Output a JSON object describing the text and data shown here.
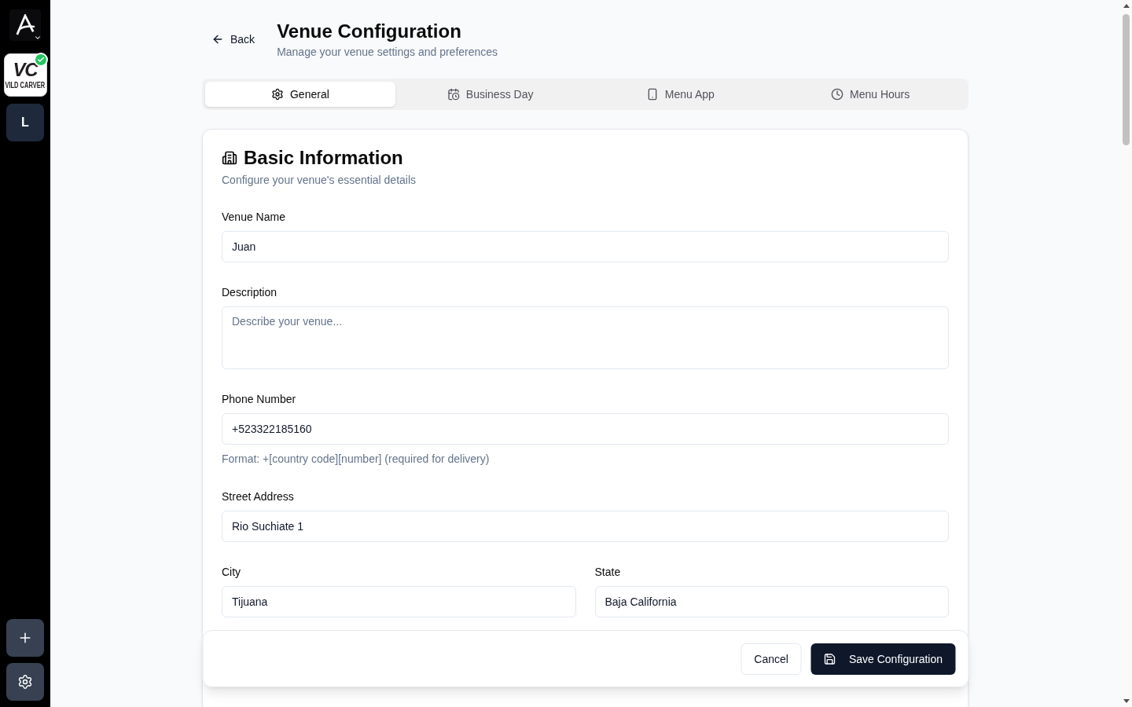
{
  "sidebar": {
    "venues": [
      {
        "kind": "logo",
        "monogram": "VC",
        "name": "VILD CARVER",
        "active": true
      },
      {
        "kind": "initial",
        "initial": "L",
        "active": false
      }
    ]
  },
  "header": {
    "back": "Back",
    "title": "Venue Configuration",
    "subtitle": "Manage your venue settings and preferences"
  },
  "tabs": [
    {
      "label": "General",
      "selected": true
    },
    {
      "label": "Business Day",
      "selected": false
    },
    {
      "label": "Menu App",
      "selected": false
    },
    {
      "label": "Menu Hours",
      "selected": false
    }
  ],
  "card": {
    "title": "Basic Information",
    "subtitle": "Configure your venue's essential details",
    "rows": [
      {
        "kind": "input",
        "label": "Venue Name",
        "value": "Juan"
      },
      {
        "kind": "textarea",
        "label": "Description",
        "placeholder": "Describe your venue..."
      },
      {
        "kind": "input",
        "label": "Phone Number",
        "value": "+523322185160",
        "help": "Format: +[country code][number] (required for delivery)"
      },
      {
        "kind": "input",
        "label": "Street Address",
        "value": "Rio Suchiate 1"
      },
      {
        "kind": "pair",
        "fields": [
          {
            "label": "City",
            "value": "Tijuana"
          },
          {
            "label": "State",
            "value": "Baja California"
          }
        ]
      }
    ]
  },
  "actions": [
    {
      "kind": "secondary",
      "label": "Cancel"
    },
    {
      "kind": "primary",
      "label": "Save Configuration"
    }
  ]
}
